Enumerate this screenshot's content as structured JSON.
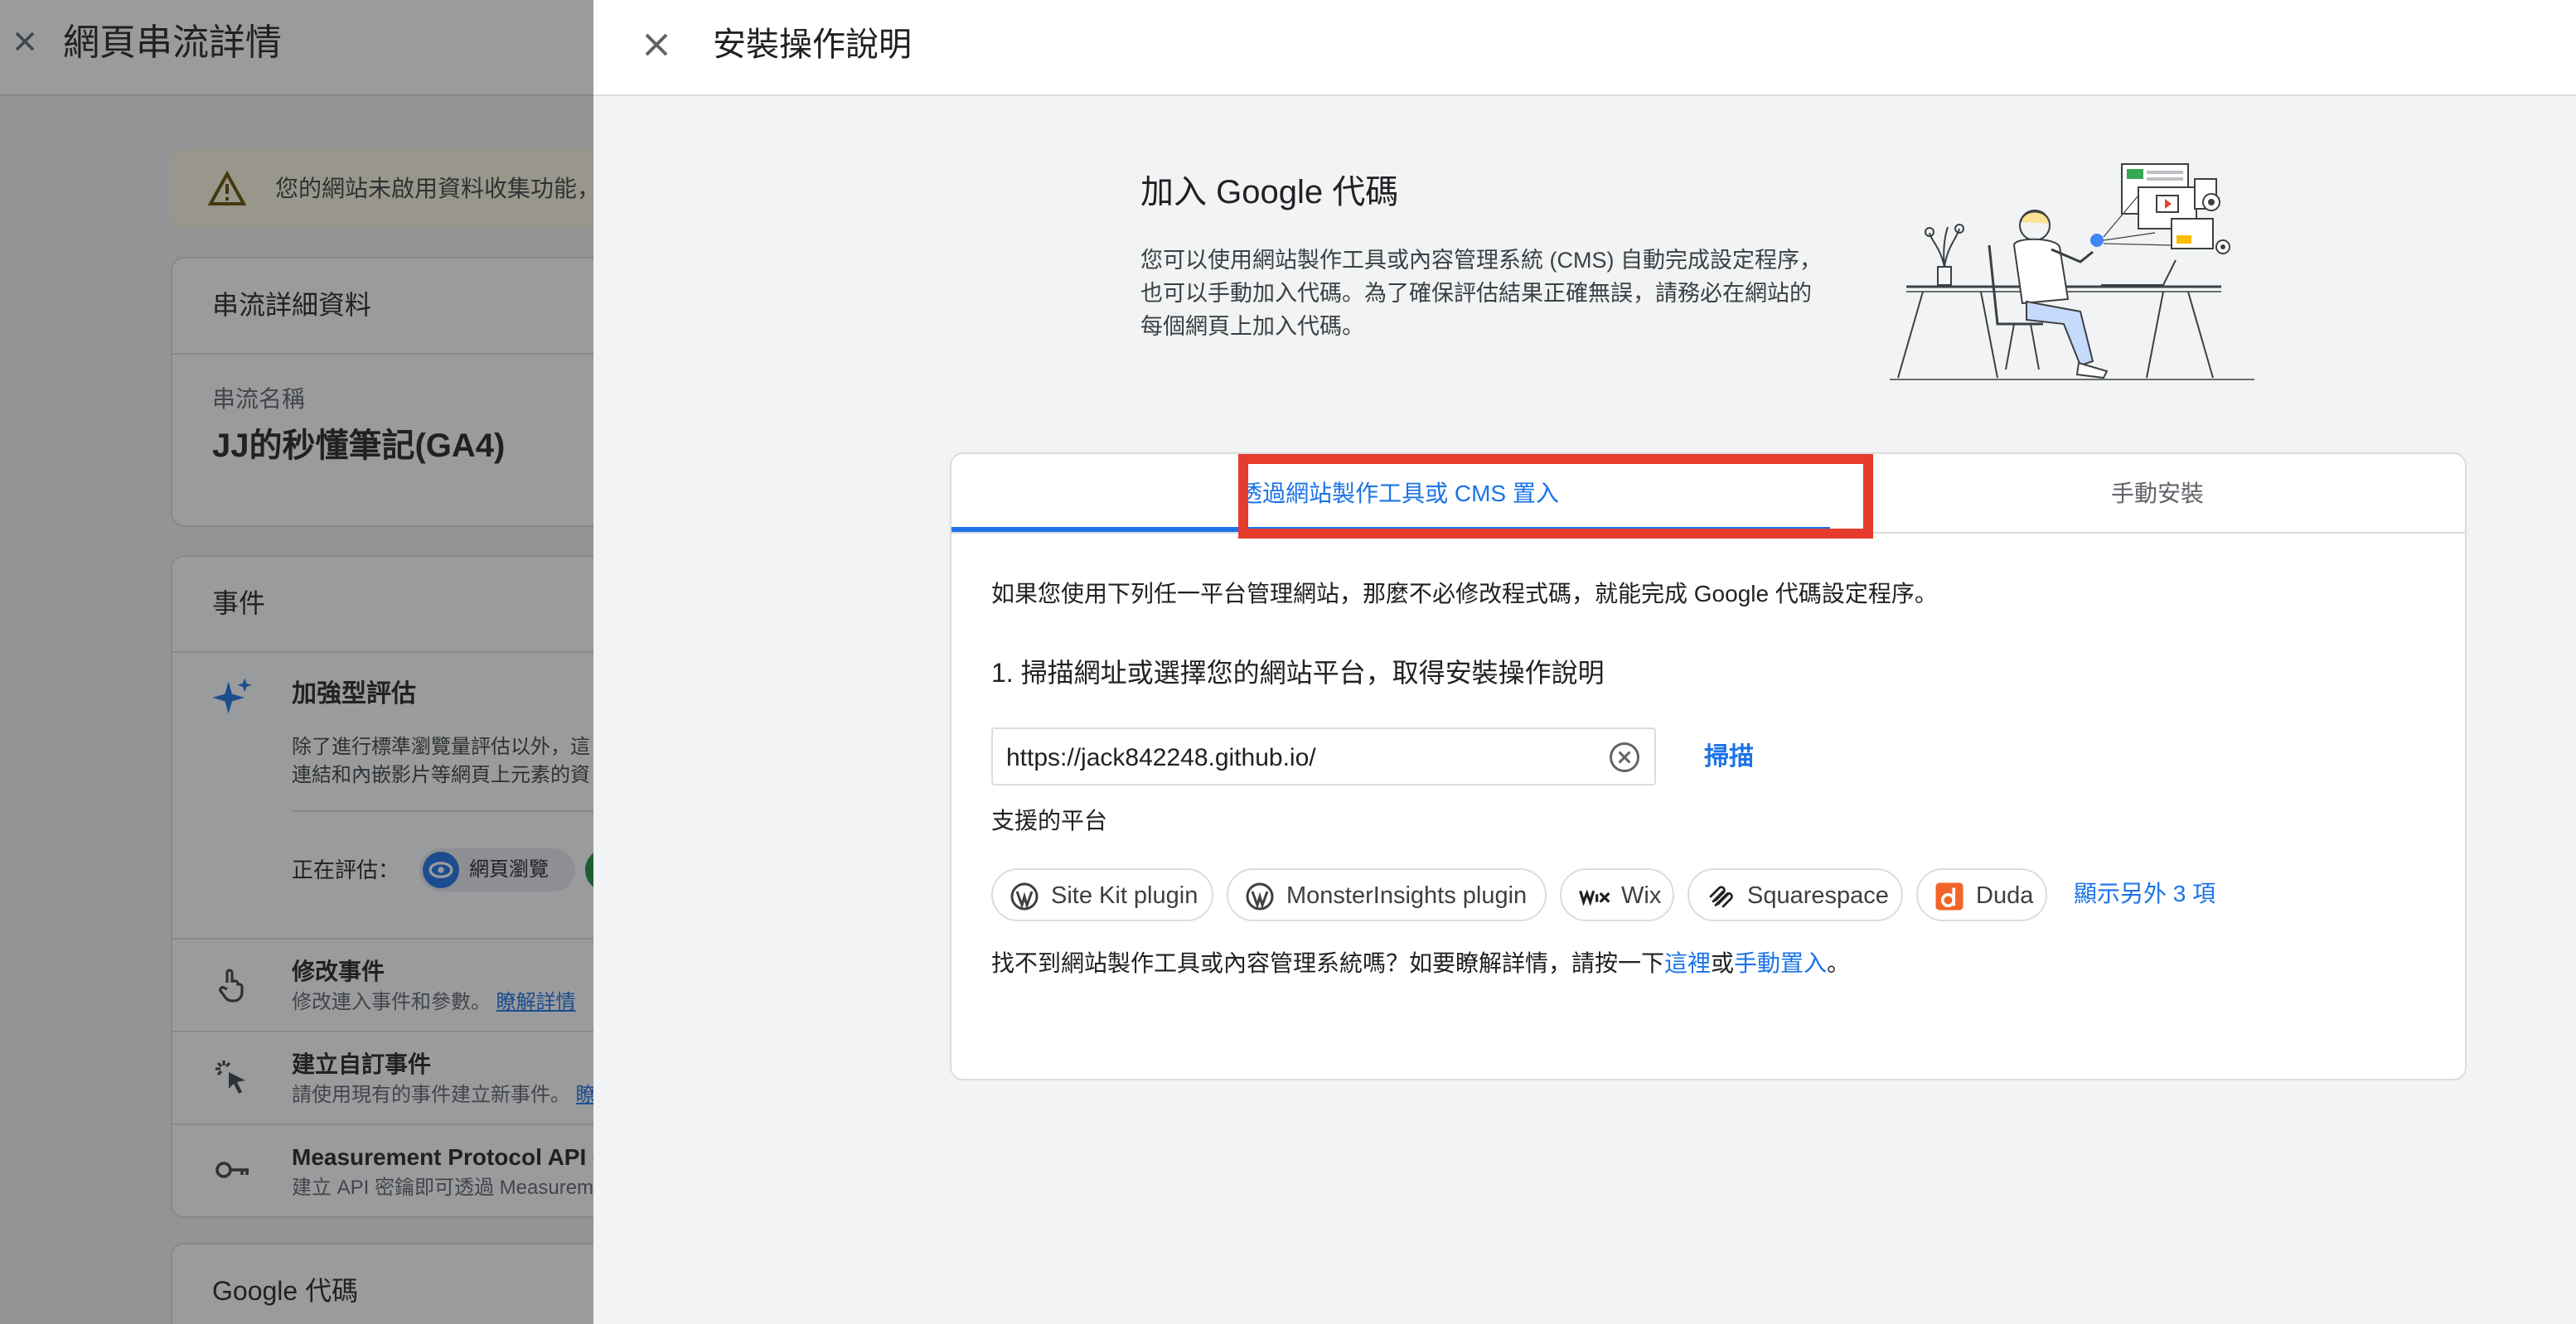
{
  "background": {
    "title": "網頁串流詳情",
    "alert_text": "您的網站未啟用資料收集功能，",
    "stream_details_title": "串流詳細資料",
    "stream_name_label": "串流名稱",
    "stream_name": "JJ的秒懂筆記(GA4)",
    "events_title": "事件",
    "enhanced": {
      "title": "加強型評估",
      "desc_line1": "除了進行標準瀏覽量評估以外，這",
      "desc_line2": "連結和內嵌影片等網頁上元素的資",
      "measuring_label": "正在評估：",
      "chip_page_views": "網頁瀏覽"
    },
    "rows": [
      {
        "title": "修改事件",
        "desc": "修改連入事件和參數。",
        "link": "瞭解詳情"
      },
      {
        "title": "建立自訂事件",
        "desc": "請使用現有的事件建立新事件。",
        "link": "瞭"
      },
      {
        "title": "Measurement Protocol API 密",
        "desc": "建立 API 密鑰即可透過 Measurem",
        "link": ""
      }
    ],
    "google_tag_title": "Google 代碼"
  },
  "panel": {
    "title": "安裝操作說明",
    "hero": {
      "title": "加入 Google 代碼",
      "desc_line1": "您可以使用網站製作工具或內容管理系統 (CMS) 自動完成設定程序，",
      "desc_line2": "也可以手動加入代碼。為了確保評估結果正確無誤，請務必在網站的",
      "desc_line3": "每個網頁上加入代碼。"
    },
    "tabs": [
      {
        "label": "透過網站製作工具或 CMS 置入",
        "active": true
      },
      {
        "label": "手動安裝",
        "active": false
      }
    ],
    "intro": "如果您使用下列任一平台管理網站，那麼不必修改程式碼，就能完成 Google 代碼設定程序。",
    "step_title": "1. 掃描網址或選擇您的網站平台，取得安裝操作說明",
    "url_input": {
      "value": "https://jack842248.github.io/"
    },
    "scan_label": "掃描",
    "platforms_label": "支援的平台",
    "platforms": [
      {
        "name": "Site Kit plugin",
        "icon": "wordpress-icon"
      },
      {
        "name": "MonsterInsights plugin",
        "icon": "wordpress-icon"
      },
      {
        "name": "Wix",
        "icon": "wix-icon"
      },
      {
        "name": "Squarespace",
        "icon": "squarespace-icon"
      },
      {
        "name": "Duda",
        "icon": "duda-icon"
      }
    ],
    "show_more": "顯示另外 3 項",
    "footer": {
      "prefix": "找不到網站製作工具或內容管理系統嗎？如要瞭解詳情，請按一下",
      "link_here": "這裡",
      "middle": "或",
      "link_manual": "手動置入",
      "suffix": "。"
    }
  },
  "colors": {
    "accent": "#1a73e8",
    "highlight": "#e53c2e",
    "warning_bg": "#fef7e0"
  }
}
